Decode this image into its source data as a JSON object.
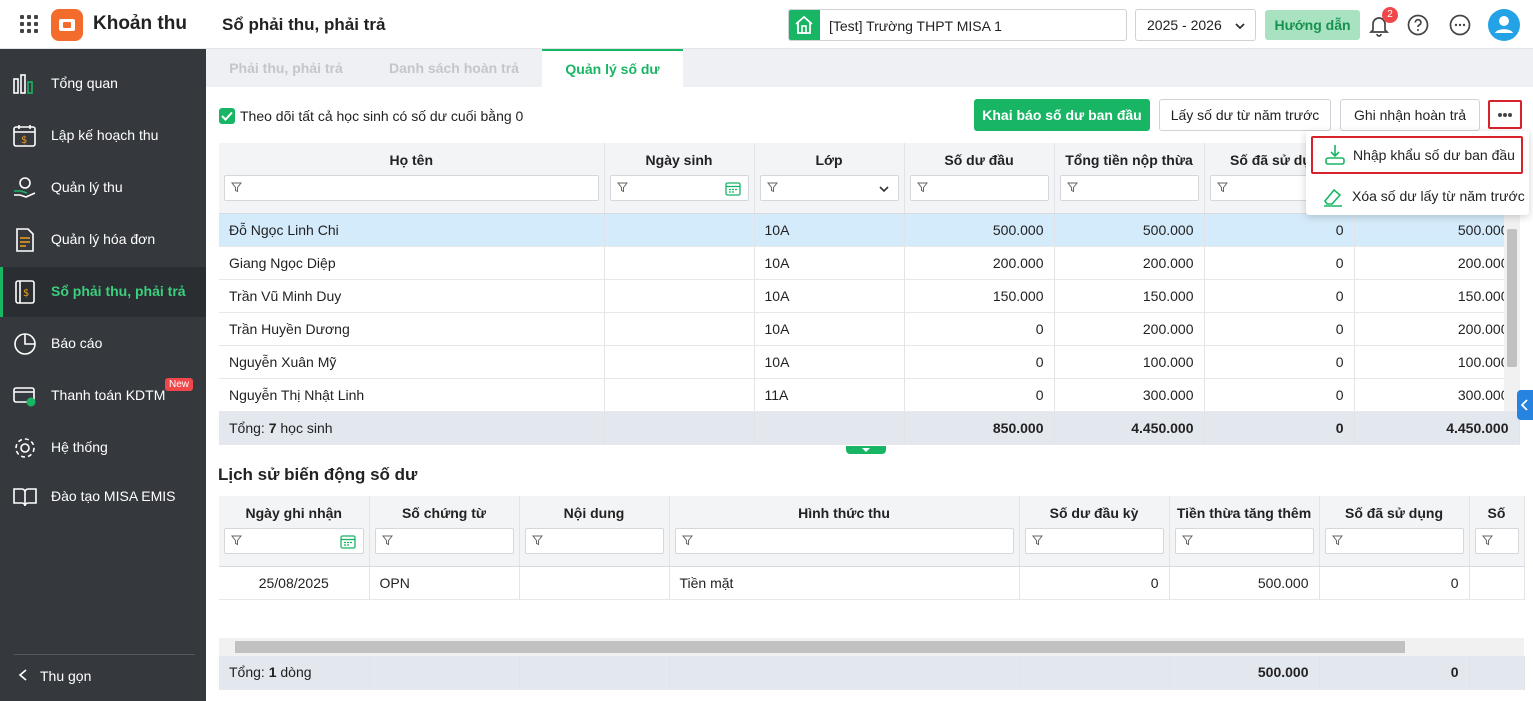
{
  "header": {
    "app_name": "Khoản thu",
    "page_title": "Sổ phải thu, phải trả",
    "school": "[Test] Trường THPT MISA 1",
    "year": "2025 - 2026",
    "guide_label": "Hướng dẫn",
    "notification_count": "2",
    "colors": {
      "accent": "#18b565",
      "sidebar": "#35393e",
      "alert": "#f0484a"
    }
  },
  "sidebar": {
    "items": [
      {
        "label": "Tổng quan",
        "icon": "chart-bars-icon"
      },
      {
        "label": "Lập kế hoạch thu",
        "icon": "calendar-money-icon"
      },
      {
        "label": "Quản lý thu",
        "icon": "hand-coin-icon"
      },
      {
        "label": "Quản lý hóa đơn",
        "icon": "invoice-icon"
      },
      {
        "label": "Sổ phải thu, phải trả",
        "icon": "ledger-book-icon",
        "active": true
      },
      {
        "label": "Báo cáo",
        "icon": "pie-chart-icon"
      },
      {
        "label": "Thanh toán KDTM",
        "icon": "card-payment-icon",
        "badge": "New"
      },
      {
        "label": "Hệ thống",
        "icon": "gear-icon"
      },
      {
        "label": "Đào tạo MISA EMIS",
        "icon": "open-book-icon"
      }
    ],
    "collapse_label": "Thu gọn"
  },
  "tabs": [
    {
      "label": "Phải thu, phải trả"
    },
    {
      "label": "Danh sách hoàn trả"
    },
    {
      "label": "Quản lý số dư",
      "active": true
    }
  ],
  "toolbar": {
    "track_zero_label": "Theo dõi tất cả học sinh có số dư cuối bằng 0",
    "declare_label": "Khai báo số dư ban đầu",
    "get_prev_label": "Lấy số dư từ năm trước",
    "record_refund_label": "Ghi nhận hoàn trả"
  },
  "menu": {
    "items": [
      {
        "label": "Nhập khẩu số dư ban đầu",
        "icon": "import-icon"
      },
      {
        "label": "Xóa số dư lấy từ năm trước",
        "icon": "eraser-icon"
      }
    ]
  },
  "balance_table": {
    "headers": [
      "Họ tên",
      "Ngày sinh",
      "Lớp",
      "Số dư đầu",
      "Tổng tiền nộp thừa",
      "Số đã sử dụng",
      ""
    ],
    "rows": [
      [
        "Đỗ Ngọc Linh Chi",
        "",
        "10A",
        "500.000",
        "500.000",
        "0",
        "500.000"
      ],
      [
        "Giang Ngọc Diệp",
        "",
        "10A",
        "200.000",
        "200.000",
        "0",
        "200.000"
      ],
      [
        "Trần Vũ Minh Duy",
        "",
        "10A",
        "150.000",
        "150.000",
        "0",
        "150.000"
      ],
      [
        "Trần Huyền Dương",
        "",
        "10A",
        "0",
        "200.000",
        "0",
        "200.000"
      ],
      [
        "Nguyễn Xuân Mỹ",
        "",
        "10A",
        "0",
        "100.000",
        "0",
        "100.000"
      ],
      [
        "Nguyễn Thị Nhật Linh",
        "",
        "11A",
        "0",
        "300.000",
        "0",
        "300.000"
      ]
    ],
    "total": {
      "prefix": "Tổng:",
      "count": "7",
      "suffix": "học sinh",
      "values": [
        "850.000",
        "4.450.000",
        "0",
        "4.450.000"
      ]
    }
  },
  "history": {
    "title": "Lịch sử biến động số dư",
    "headers": [
      "Ngày ghi nhận",
      "Số chứng từ",
      "Nội dung",
      "Hình thức thu",
      "Số dư đầu kỳ",
      "Tiền thừa tăng thêm",
      "Số đã sử dụng",
      "Số"
    ],
    "rows": [
      [
        "25/08/2025",
        "OPN",
        "",
        "Tiền mặt",
        "0",
        "500.000",
        "0",
        ""
      ]
    ],
    "total": {
      "prefix": "Tổng:",
      "count": "1",
      "suffix": "dòng",
      "values": [
        "500.000",
        "0"
      ]
    }
  }
}
